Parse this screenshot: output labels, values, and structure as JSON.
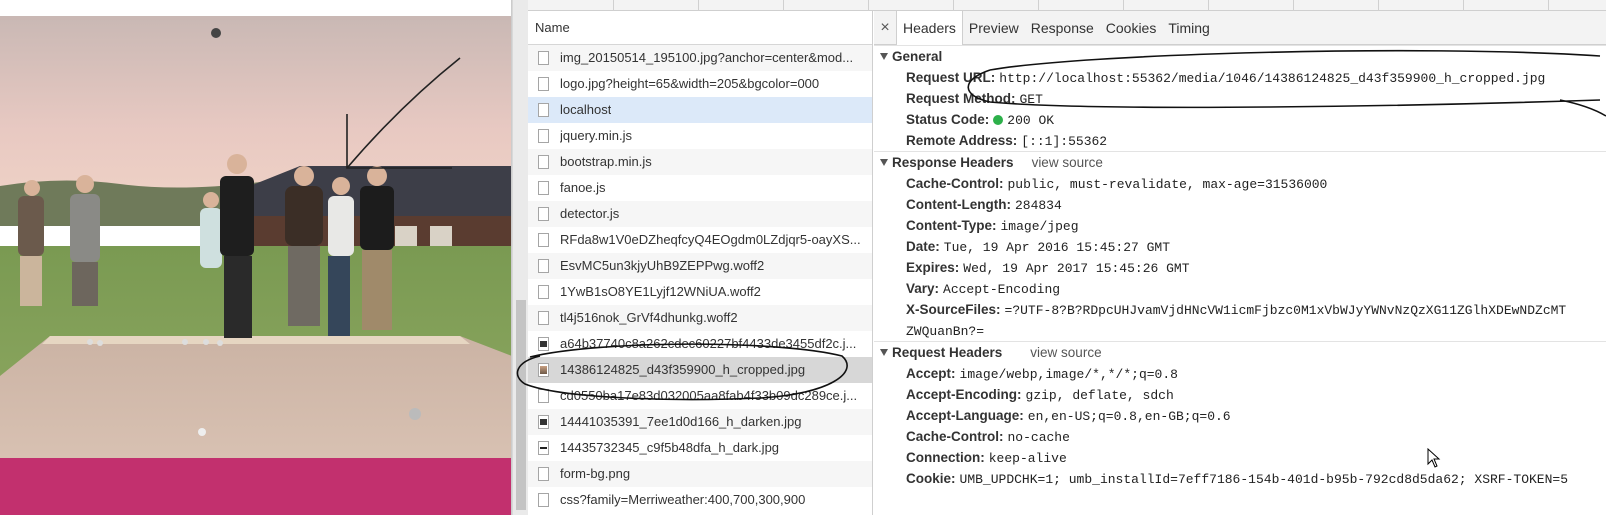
{
  "network": {
    "name_header": "Name",
    "requests": [
      {
        "name": "img_20150514_195100.jpg?anchor=center&mod...",
        "icon": "file-icon",
        "state": ""
      },
      {
        "name": "logo.jpg?height=65&width=205&bgcolor=000",
        "icon": "file-icon",
        "state": ""
      },
      {
        "name": "localhost",
        "icon": "file-icon",
        "state": "selected"
      },
      {
        "name": "jquery.min.js",
        "icon": "file-icon",
        "state": ""
      },
      {
        "name": "bootstrap.min.js",
        "icon": "file-icon",
        "state": ""
      },
      {
        "name": "fanoe.js",
        "icon": "file-icon",
        "state": ""
      },
      {
        "name": "detector.js",
        "icon": "file-icon",
        "state": ""
      },
      {
        "name": "RFda8w1V0eDZheqfcyQ4EOgdm0LZdjqr5-oayXS...",
        "icon": "file-icon",
        "state": ""
      },
      {
        "name": "EsvMC5un3kjyUhB9ZEPPwg.woff2",
        "icon": "file-icon",
        "state": ""
      },
      {
        "name": "1YwB1sO8YE1Lyjf12WNiUA.woff2",
        "icon": "file-icon",
        "state": ""
      },
      {
        "name": "tl4j516nok_GrVf4dhunkg.woff2",
        "icon": "file-icon",
        "state": ""
      },
      {
        "name": "a64b37740c8a262cdec60227bf4433de3455df2c.j...",
        "icon": "image-dark-icon",
        "state": ""
      },
      {
        "name": "14386124825_d43f359900_h_cropped.jpg",
        "icon": "image-photo-icon",
        "state": "highlight"
      },
      {
        "name": "cd0550ba17e83d032005aa8fab4f33b09dc289ce.j...",
        "icon": "file-icon",
        "state": ""
      },
      {
        "name": "14441035391_7ee1d0d166_h_darken.jpg",
        "icon": "image-dark-icon",
        "state": ""
      },
      {
        "name": "14435732345_c9f5b48dfa_h_dark.jpg",
        "icon": "image-bar-icon",
        "state": ""
      },
      {
        "name": "form-bg.png",
        "icon": "file-icon",
        "state": ""
      },
      {
        "name": "css?family=Merriweather:400,700,300,900",
        "icon": "file-icon",
        "state": ""
      }
    ]
  },
  "details": {
    "close_glyph": "×",
    "tabs": [
      "Headers",
      "Preview",
      "Response",
      "Cookies",
      "Timing"
    ],
    "active_tab": "Headers",
    "view_source": "view source",
    "general": {
      "title": "General",
      "rows": [
        {
          "key": "Request URL:",
          "value": "http://localhost:55362/media/1046/14386124825_d43f359900_h_cropped.jpg"
        },
        {
          "key": "Request Method:",
          "value": "GET"
        },
        {
          "key": "Status Code:",
          "value": "200 OK",
          "status_color": "#2db04a"
        },
        {
          "key": "Remote Address:",
          "value": "[::1]:55362"
        }
      ]
    },
    "response_headers": {
      "title": "Response Headers",
      "rows": [
        {
          "key": "Cache-Control:",
          "value": "public, must-revalidate, max-age=31536000"
        },
        {
          "key": "Content-Length:",
          "value": "284834"
        },
        {
          "key": "Content-Type:",
          "value": "image/jpeg"
        },
        {
          "key": "Date:",
          "value": "Tue, 19 Apr 2016 15:45:27 GMT"
        },
        {
          "key": "Expires:",
          "value": "Wed, 19 Apr 2017 15:45:26 GMT"
        },
        {
          "key": "Vary:",
          "value": "Accept-Encoding"
        },
        {
          "key": "X-SourceFiles:",
          "value": "=?UTF-8?B?RDpcUHJvamVjdHNcVW1icmFjbzc0M1xVbWJyYWNvNzQzXG11ZGlhXDEwNDZcMT"
        },
        {
          "key": "",
          "value": "ZWQuanBn?="
        }
      ]
    },
    "request_headers": {
      "title": "Request Headers",
      "rows": [
        {
          "key": "Accept:",
          "value": "image/webp,image/*,*/*;q=0.8"
        },
        {
          "key": "Accept-Encoding:",
          "value": "gzip, deflate, sdch"
        },
        {
          "key": "Accept-Language:",
          "value": "en,en-US;q=0.8,en-GB;q=0.6"
        },
        {
          "key": "Cache-Control:",
          "value": "no-cache"
        },
        {
          "key": "Connection:",
          "value": "keep-alive"
        },
        {
          "key": "Cookie:",
          "value": "UMB_UPDCHK=1; umb_installId=7eff7186-154b-401d-b95b-792cd8d5da62; XSRF-TOKEN=5"
        }
      ]
    }
  },
  "colors": {
    "page_band": "#c2306e",
    "selected_row": "#dce9f9",
    "highlight_row": "#d7d7d7",
    "status_ok": "#2db04a"
  }
}
